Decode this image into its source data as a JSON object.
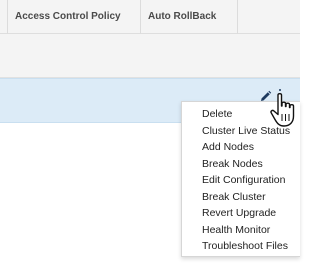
{
  "table": {
    "columns": [
      "Access Control Policy",
      "Auto RollBack"
    ]
  },
  "menu": {
    "items": [
      "Delete",
      "Cluster Live Status",
      "Add Nodes",
      "Break Nodes",
      "Edit Configuration",
      "Break Cluster",
      "Revert Upgrade",
      "Health Monitor",
      "Troubleshoot Files"
    ]
  },
  "icons": {
    "edit": "pencil-icon",
    "more": "kebab-icon",
    "cursor": "hand-pointer-icon"
  },
  "colors": {
    "selected_row": "#dcebf7",
    "header_bg": "#f4f4f4",
    "icon": "#1e3a5f"
  }
}
